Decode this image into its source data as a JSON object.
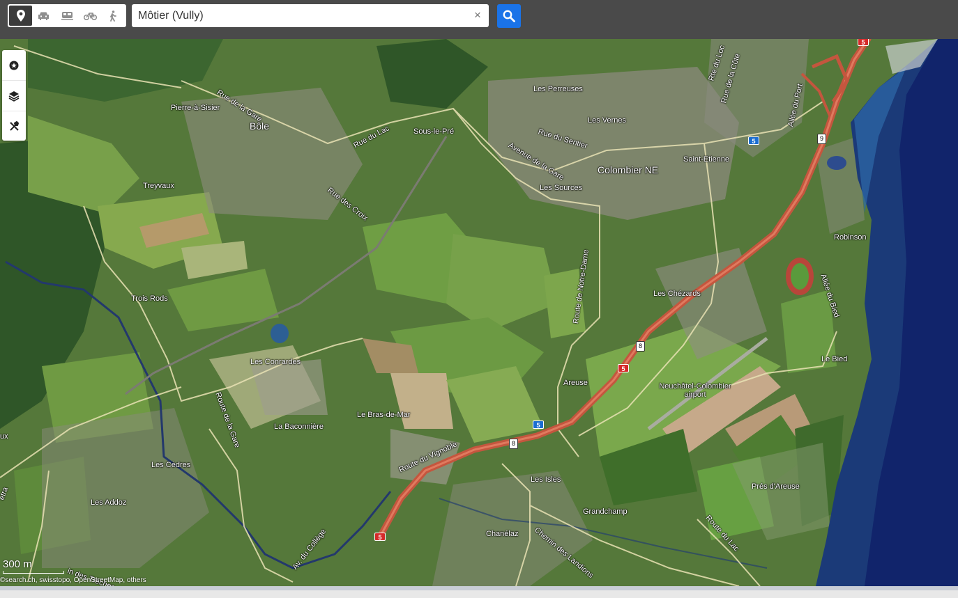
{
  "toolbar": {
    "modes": [
      {
        "icon": "location-pin-icon",
        "active": true
      },
      {
        "icon": "car-icon",
        "active": false
      },
      {
        "icon": "train-icon",
        "active": false
      },
      {
        "icon": "bicycle-icon",
        "active": false
      },
      {
        "icon": "walking-icon",
        "active": false
      }
    ],
    "search_value": "Môtier (Vully)",
    "clear_symbol": "×",
    "search_button_icon": "magnifier-icon",
    "accent_color": "#1a73e8"
  },
  "map_tools": [
    "star-icon",
    "layers-icon",
    "tools-icon"
  ],
  "map": {
    "places": {
      "pierre_a_sisier": "Pierre-à-Sisier",
      "bole": "Bôle",
      "treyvaux": "Treyvaux",
      "trois_rods_road": "Trois Rods",
      "trois_rods": "Trois Rods",
      "les_perreuses": "Les Perreuses",
      "les_vernes": "Les Vernes",
      "sous_le_pre": "Sous-le-Pré",
      "colombier": "Colombier NE",
      "saint_etienne": "Saint-Etienne",
      "les_sources": "Les Sources",
      "robinson": "Robinson",
      "les_chezards": "Les Chézards",
      "les_conrardes": "Les Conrardes",
      "areuse": "Areuse",
      "le_bied": "Le Bied",
      "airport": "Neuchâtel-Colombier airport",
      "le_bras_de_mar": "Le Bras-de-Mar",
      "la_baconniere": "La Baconnière",
      "les_cedres": "Les Cèdres",
      "les_isles": "Les Isles",
      "pres_d_areuse": "Prés d'Areuse",
      "les_addoz": "Les Addoz",
      "grandchamp": "Grandchamp",
      "chanelaz": "Chanélaz"
    },
    "streets": {
      "rue_de_la_gare": "Rue de la Gare",
      "rue_du_lac": "Rue du Lac",
      "rue_du_sentier": "Rue du Sentier",
      "avenue_de_la_gare": "Avenue de la Gare",
      "rue_des_croix": "Rue des Croix",
      "route_de_notre_dame": "Route de Notre-Dame",
      "allee_du_port": "Allée du Port",
      "rte_du_loc": "Rte du Loc",
      "rue_de_la_cote": "Rue de la Côte",
      "allee_du_bied": "Allée du Bied",
      "route_de_la_gare": "Route de la Gare",
      "route_du_vignoble": "Route du Vignoble",
      "av_du_college": "Av. du Collège",
      "chemin_des_landions": "Chemin des Landions",
      "route_du_lac": "Route du Lac",
      "chemin_des_treches": "in des Trèches",
      "left_edge_1": "ux",
      "left_edge_2": "etra"
    },
    "shields": {
      "a5": "5",
      "exit8": "8",
      "exit9": "9"
    },
    "scale": "300 m",
    "attribution": "©search.ch, swisstopo, OpenStreetMap, others"
  }
}
